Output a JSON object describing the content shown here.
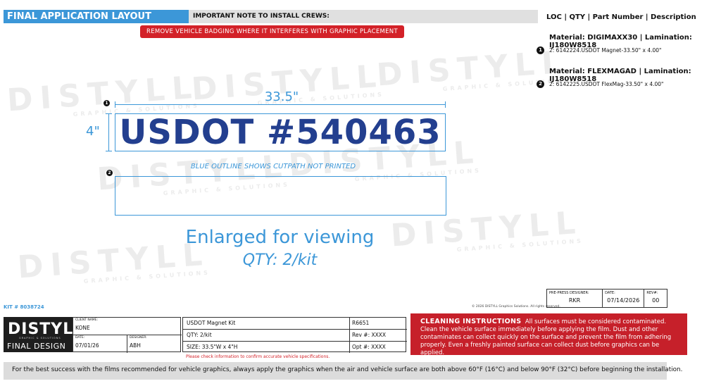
{
  "header": {
    "title": "FINAL APPLICATION LAYOUT",
    "note_label": "IMPORTANT NOTE TO INSTALL CREWS:",
    "badge_note": "REMOVE VEHICLE BADGING WHERE IT INTERFERES WITH GRAPHIC PLACEMENT"
  },
  "watermark": {
    "word": "DISTYLL",
    "tagline": "GRAPHIC & SOLUTIONS"
  },
  "parts_panel": {
    "header": "LOC | QTY | Part Number | Description",
    "materials": [
      {
        "material": "Material: DIGIMAXX30 | Lamination: IJ180W8518",
        "loc": "1",
        "part": "2: 6142224.USDOT Magnet-33.50\" x 4.00\""
      },
      {
        "material": "Material: FLEXMAGAD | Lamination: IJ180W8518",
        "loc": "2",
        "part": "2: 6142225.USDOT FlexMag-33.50\" x 4.00\""
      }
    ]
  },
  "graphic": {
    "width_dim": "33.5\"",
    "height_dim": "4\"",
    "loc1": "1",
    "loc2": "2",
    "text": "USDOT #540463",
    "cutpath_note": "BLUE OUTLINE SHOWS CUTPATH NOT PRINTED",
    "enlarged": "Enlarged for viewing",
    "qty": "QTY: 2/kit"
  },
  "kit_number": "KIT # 8038724",
  "copyright": "© 2026 DISTYLL Graphics Solutions. All rights reserved.",
  "prepress": {
    "designer_label": "PRE-PRESS DESIGNER:",
    "designer": "RKR",
    "date_label": "DATE:",
    "date": "07/14/2026",
    "rev_label": "REV#:",
    "rev": "00"
  },
  "logo": {
    "name": "DISTYLL",
    "tagline": "GRAPHIC & SOLUTIONS",
    "final_design": "FINAL DESIGN"
  },
  "client": {
    "client_label": "CLIENT NAME:",
    "client": "KONE",
    "date_label": "DATE:",
    "date": "07/01/26",
    "designer_label": "DESIGNER:",
    "designer": "ABH"
  },
  "job": {
    "name": "USDOT Magnet Kit",
    "number": "R6651",
    "qty": "QTY: 2/kit",
    "rev": "Rev #:  XXXX",
    "size": "SIZE: 33.5\"W x 4\"H",
    "opt": "Opt #:  XXXX"
  },
  "check_note": "Please check information to confirm accurate vehicle specifications.",
  "cleaning": {
    "title": "CLEANING INSTRUCTIONS",
    "text": "All surfaces must be considered contaminated. Clean the vehicle surface immediately before applying the film. Dust and other contaminates can collect quickly on the surface and prevent the film from adhering properly. Even a freshly painted surface can collect dust before graphics can be applied."
  },
  "footer": "For the best success with the films recommended for vehicle graphics, always apply the graphics when the air and vehicle surface are both above 60°F (16°C) and below 90°F (32°C) before beginning the installation.",
  "colors": {
    "accent_blue": "#3c97d8",
    "graphic_navy": "#233f8f",
    "alert_red": "#d32128",
    "logo_black": "#1e1e1e"
  }
}
